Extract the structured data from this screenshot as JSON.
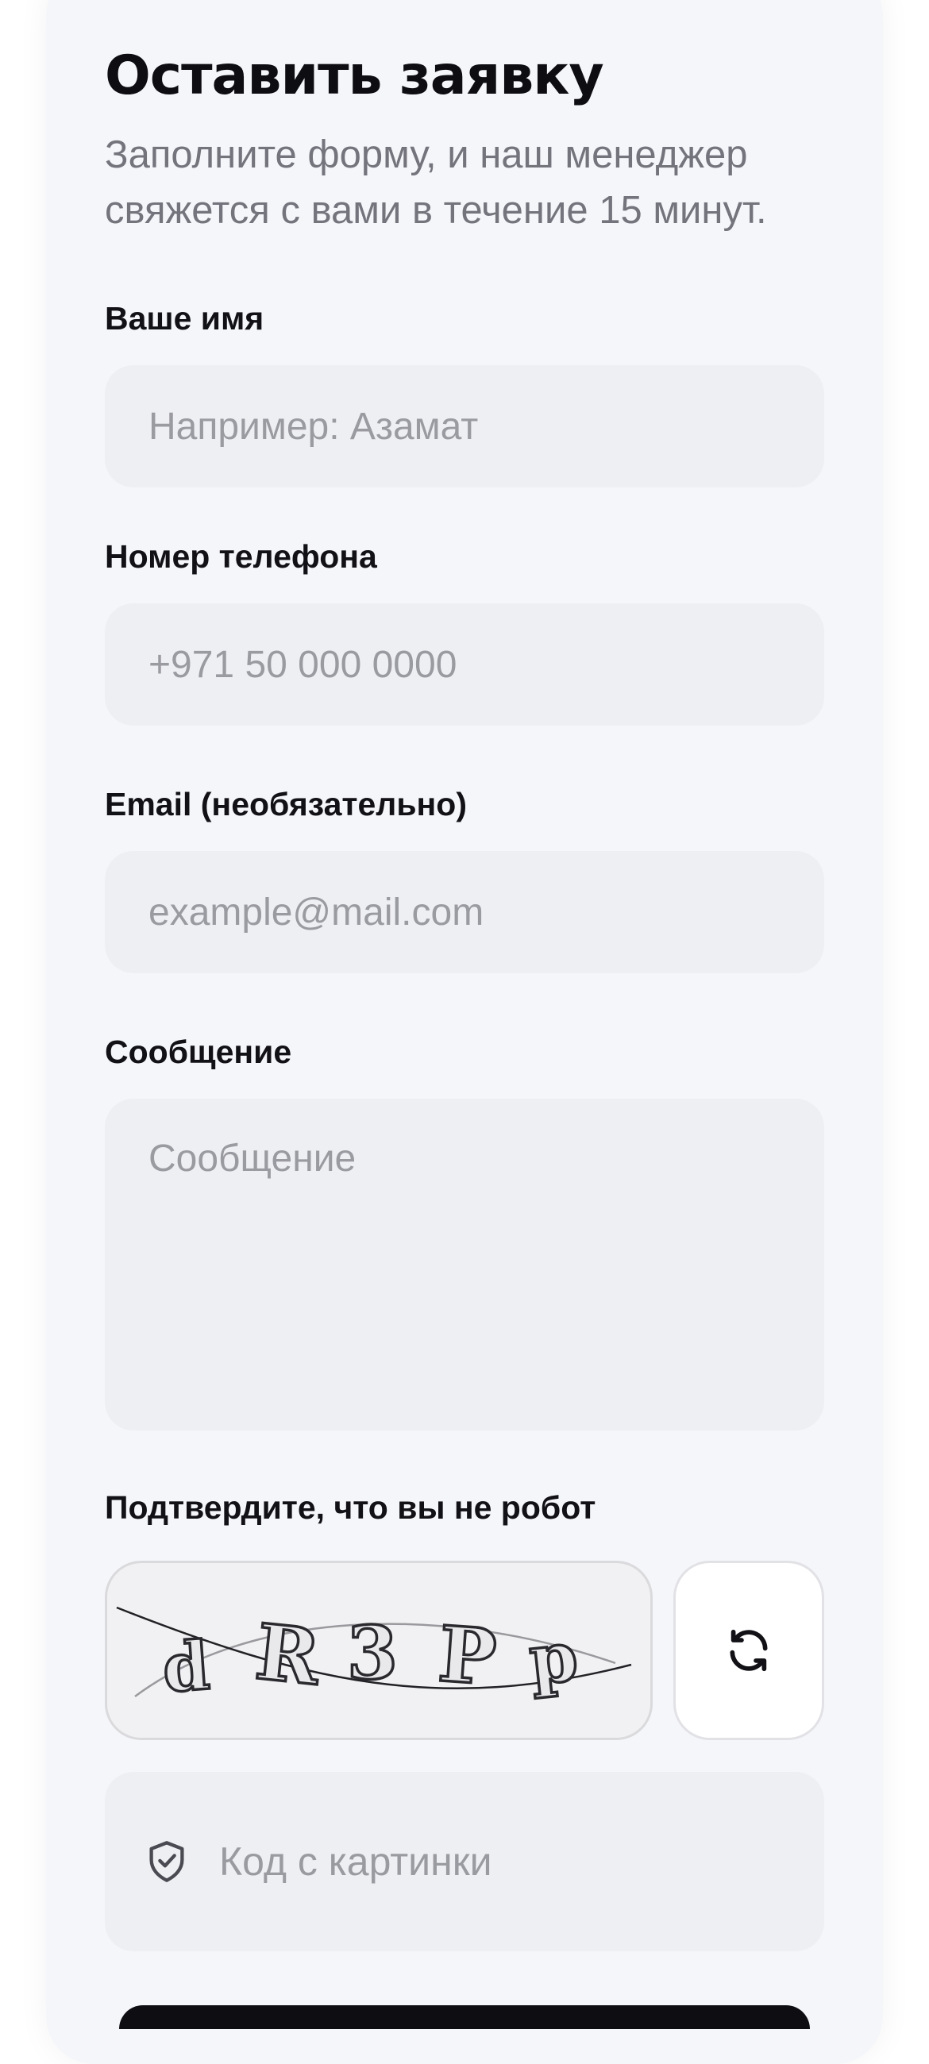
{
  "form": {
    "title": "Оставить заявку",
    "subtitle": "Заполните форму, и наш менеджер свяжется с вами в течение 15 минут.",
    "name": {
      "label": "Ваше имя",
      "placeholder": "Например: Азамат"
    },
    "phone": {
      "label": "Номер телефона",
      "placeholder": "+971 50 000 0000"
    },
    "email": {
      "label": "Email (необязательно)",
      "placeholder": "example@mail.com"
    },
    "message": {
      "label": "Сообщение",
      "placeholder": "Сообщение"
    },
    "captcha": {
      "label": "Подтвердите, что вы не робот",
      "chars": [
        "d",
        "R",
        "3",
        "P",
        "p"
      ],
      "refresh_icon": "refresh-icon",
      "code_icon": "shield-check-icon",
      "code_placeholder": "Код с картинки"
    }
  },
  "colors": {
    "card_bg": "#f5f6fa",
    "field_bg": "#eeeff3",
    "title": "#0d0d12",
    "placeholder": "#9a9aa1",
    "subtitle": "#74747d"
  }
}
